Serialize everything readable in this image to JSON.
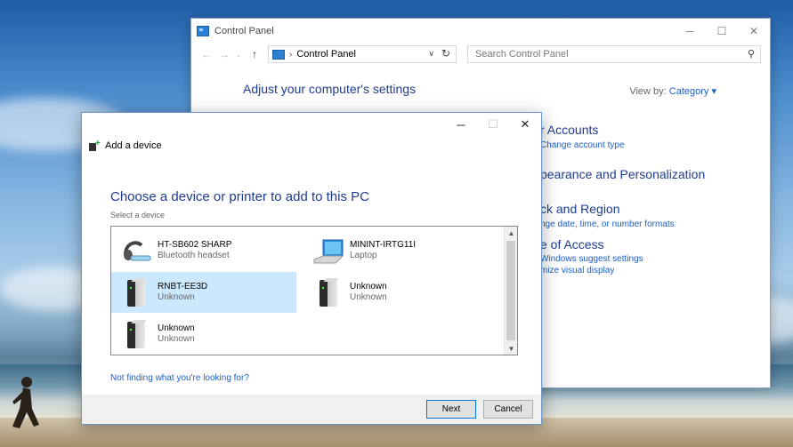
{
  "colors": {
    "accent": "#1a5fc8",
    "heading": "#1e3c90",
    "selection": "#cce8ff"
  },
  "control_panel": {
    "title": "Control Panel",
    "breadcrumb": "Control Panel",
    "search_placeholder": "Search Control Panel",
    "heading": "Adjust your computer's settings",
    "view_by_label": "View by:",
    "view_by_value": "Category ▾",
    "categories": [
      {
        "title": "r Accounts",
        "links": [
          "Change account type"
        ]
      },
      {
        "title": "pearance and Personalization",
        "links": []
      },
      {
        "title": "ck and Region",
        "links": [
          "nge date, time, or number formats"
        ]
      },
      {
        "title": "e of Access",
        "links": [
          "Windows suggest settings",
          "mize visual display"
        ]
      }
    ]
  },
  "dialog": {
    "title": "Add a device",
    "heading": "Choose a device or printer to add to this PC",
    "subheading": "Select a device",
    "devices": [
      {
        "name": "HT-SB602 SHARP",
        "type": "Bluetooth headset",
        "icon": "headset-icon",
        "selected": false
      },
      {
        "name": "MININT-IRTG11I",
        "type": "Laptop",
        "icon": "laptop-icon",
        "selected": false
      },
      {
        "name": "RNBT-EE3D",
        "type": "Unknown",
        "icon": "computer-tower-icon",
        "selected": true
      },
      {
        "name": "Unknown",
        "type": "Unknown",
        "icon": "computer-tower-icon",
        "selected": false
      },
      {
        "name": "Unknown",
        "type": "Unknown",
        "icon": "computer-tower-icon",
        "selected": false
      }
    ],
    "help_link": "Not finding what you're looking for?",
    "next_label": "Next",
    "cancel_label": "Cancel"
  }
}
